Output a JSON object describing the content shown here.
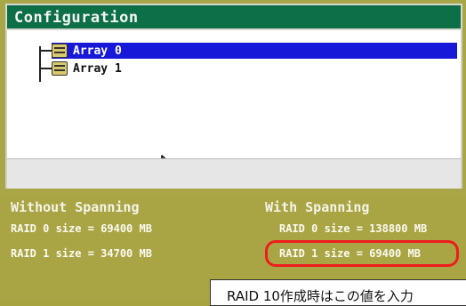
{
  "window": {
    "title": "Configuration"
  },
  "tree": {
    "items": [
      {
        "label": "Array 0",
        "selected": true
      },
      {
        "label": "Array 1",
        "selected": false
      }
    ],
    "icon": "disk-array-icon"
  },
  "info": {
    "without_spanning": {
      "heading": "Without Spanning",
      "raid0": "RAID 0 size = 69400 MB",
      "raid1": "RAID 1 size = 34700 MB"
    },
    "with_spanning": {
      "heading": "With Spanning",
      "raid0": "RAID 0 size = 138800 MB",
      "raid1": "RAID 1 size = 69400 MB"
    }
  },
  "annotation": {
    "callout": "RAID 10作成時はこの値を入力"
  },
  "colors": {
    "titlebar": "#0c6f48",
    "selection": "#1818d8",
    "panel_background": "#aaa544",
    "highlight_ring": "#ee1c1c"
  }
}
